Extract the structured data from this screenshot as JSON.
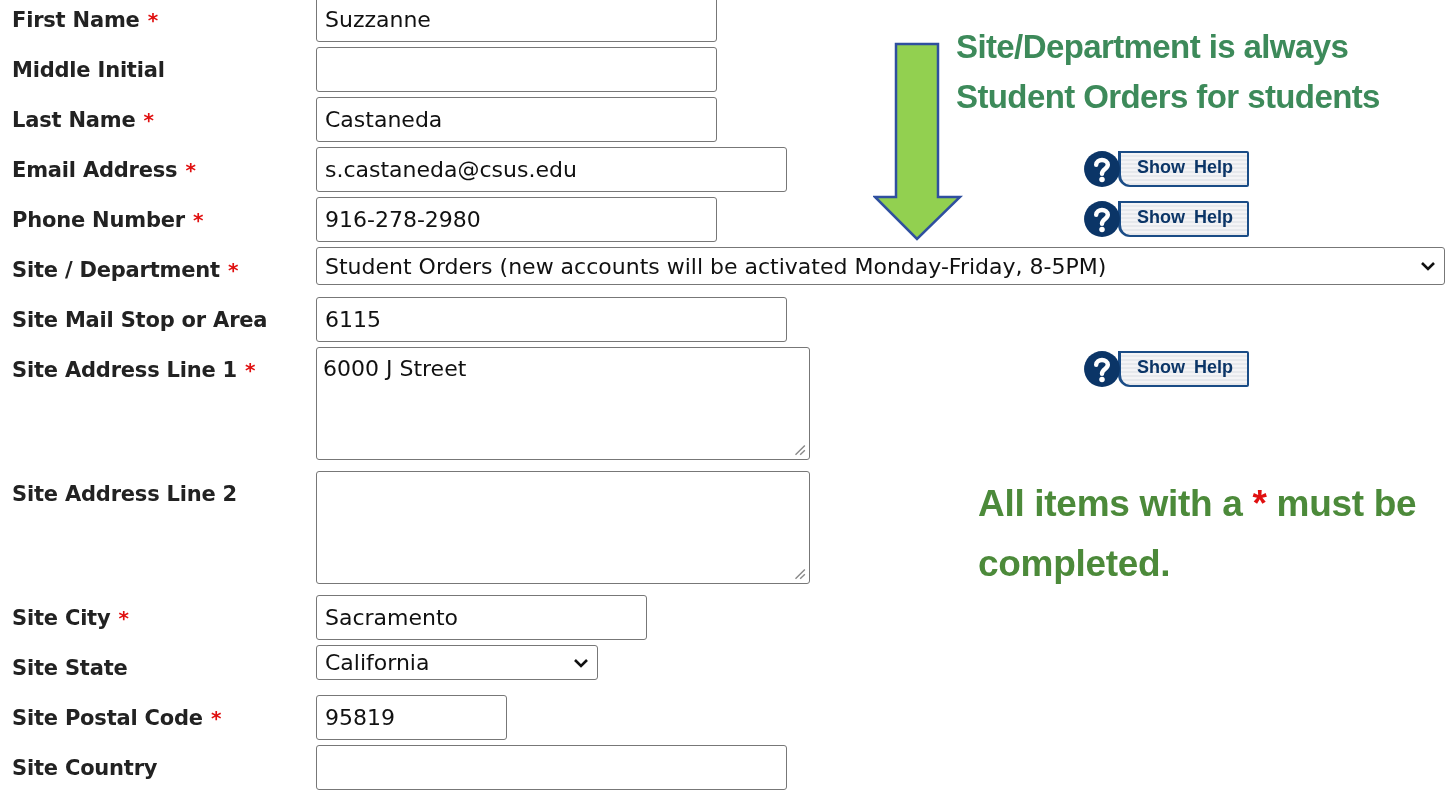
{
  "fields": [
    {
      "label": "First Name",
      "required": true,
      "kind": "text",
      "value": "Suzzanne"
    },
    {
      "label": "Middle Initial",
      "required": false,
      "kind": "text"
    },
    {
      "label": "Last Name",
      "required": true,
      "kind": "text",
      "value": "Castaneda"
    },
    {
      "label": "Email Address",
      "required": true,
      "kind": "text",
      "value": "s.castaneda@csus.edu",
      "help": "Show Help"
    },
    {
      "label": "Phone Number",
      "required": true,
      "kind": "text",
      "value": "916-278-2980",
      "help": "Show Help"
    },
    {
      "label": "Site / Department",
      "required": true,
      "kind": "select",
      "value": "Student Orders (new accounts will be activated Monday-Friday, 8-5PM)"
    },
    {
      "label": "Site Mail Stop or Area",
      "required": false,
      "kind": "text",
      "value": "6115"
    },
    {
      "label": "Site Address Line 1",
      "required": true,
      "kind": "textarea",
      "value": "6000 J Street",
      "help": "Show Help"
    },
    {
      "label": "Site Address Line 2",
      "required": false,
      "kind": "textarea"
    },
    {
      "label": "Site City",
      "required": true,
      "kind": "text",
      "value": "Sacramento"
    },
    {
      "label": "Site State",
      "required": false,
      "kind": "select",
      "value": "California"
    },
    {
      "label": "Site Postal Code",
      "required": true,
      "kind": "text",
      "value": "95819"
    },
    {
      "label": "Site Country",
      "required": false,
      "kind": "text"
    }
  ],
  "required_mark": "*",
  "callout": {
    "line_1": "Site/Department is always",
    "line_2": "Student Orders for students"
  },
  "note": {
    "before": "All items with a",
    "mark": "*",
    "after": "must be completed."
  }
}
